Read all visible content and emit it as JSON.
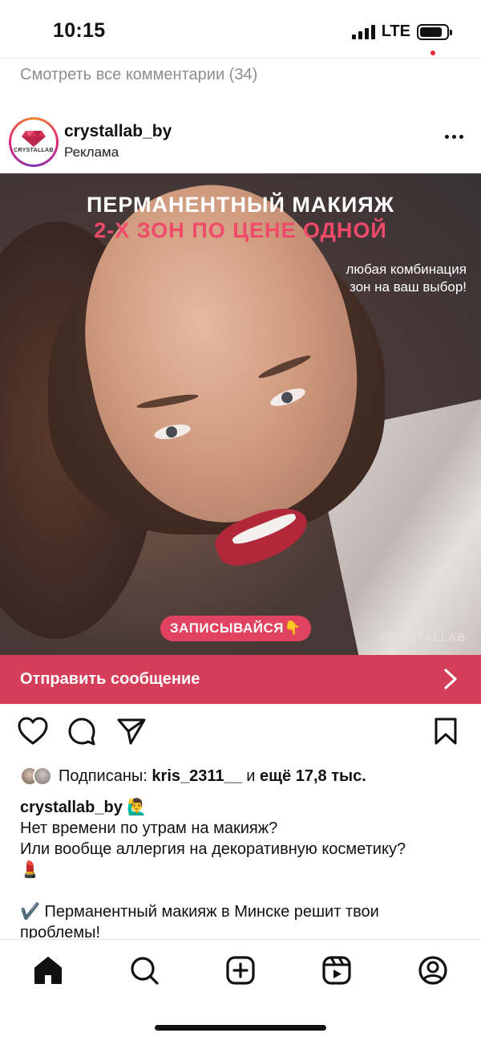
{
  "status_bar": {
    "time": "10:15",
    "network": "LTE",
    "battery_level": 0.85
  },
  "comments": {
    "view_all": "Смотреть все комментарии (34)"
  },
  "post": {
    "account": "crystallab_by",
    "sponsored_label": "Реклама",
    "avatar_logo_text": "CRYSTALLAB",
    "more_icon": "more-horizontal-icon"
  },
  "ad": {
    "headline_1": "ПЕРМАНЕНТНЫЙ МАКИЯЖ",
    "headline_2": "2-Х ЗОН ПО ЦЕНЕ ОДНОЙ",
    "subtext_1": "любая комбинация",
    "subtext_2": "зон на ваш выбор!",
    "cta": "ЗАПИСЫВАЙСЯ👇",
    "watermark": "CRYSTALLAB",
    "accent_color": "#e0425f"
  },
  "send_message": {
    "label": "Отправить сообщение",
    "icon": "chevron-right-icon",
    "bar_color": "#d43e59"
  },
  "actions": {
    "like_icon": "heart-icon",
    "comment_icon": "comment-icon",
    "share_icon": "send-icon",
    "save_icon": "bookmark-icon"
  },
  "likes": {
    "prefix": "Подписаны: ",
    "user": "kris_2311__",
    "middle": " и ",
    "others": "ещё 17,8 тыс."
  },
  "caption": {
    "user": "crystallab_by",
    "user_emoji": "🙋‍♂️",
    "line1": "Нет времени по утрам на макияж?",
    "line2": "Или вообще аллергия на декоративную косметику?",
    "line3": "💄",
    "line4": "✔️ Перманентный макияж в Минске решит твои",
    "line5": "проблемы!"
  },
  "bottom_nav": {
    "items": [
      "home-icon",
      "search-icon",
      "create-icon",
      "reels-icon",
      "profile-icon"
    ],
    "active": "home-icon"
  }
}
